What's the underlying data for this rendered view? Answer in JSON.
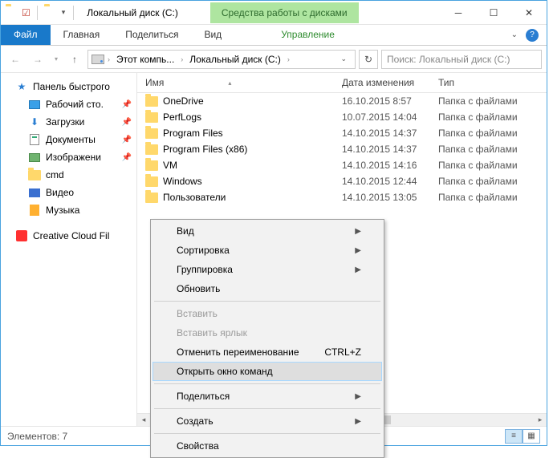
{
  "title": "Локальный диск (C:)",
  "drive_tools": "Средства работы с дисками",
  "ribbon": {
    "file": "Файл",
    "home": "Главная",
    "share": "Поделиться",
    "view": "Вид",
    "manage": "Управление"
  },
  "breadcrumb": {
    "pc": "Этот компь...",
    "drive": "Локальный диск (C:)"
  },
  "search_placeholder": "Поиск: Локальный диск (С:)",
  "nav": {
    "quick": "Панель быстрого",
    "desktop": "Рабочий сто.",
    "downloads": "Загрузки",
    "documents": "Документы",
    "pictures": "Изображени",
    "cmd": "cmd",
    "video": "Видео",
    "music": "Музыка",
    "cc": "Creative Cloud Fil"
  },
  "columns": {
    "name": "Имя",
    "date": "Дата изменения",
    "type": "Тип"
  },
  "folder_type": "Папка с файлами",
  "rows": [
    {
      "name": "OneDrive",
      "date": "16.10.2015 8:57"
    },
    {
      "name": "PerfLogs",
      "date": "10.07.2015 14:04"
    },
    {
      "name": "Program Files",
      "date": "14.10.2015 14:37"
    },
    {
      "name": "Program Files (x86)",
      "date": "14.10.2015 14:37"
    },
    {
      "name": "VM",
      "date": "14.10.2015 14:16"
    },
    {
      "name": "Windows",
      "date": "14.10.2015 12:44"
    },
    {
      "name": "Пользователи",
      "date": "14.10.2015 13:05"
    }
  ],
  "status": "Элементов: 7",
  "ctx": {
    "view": "Вид",
    "sort": "Сортировка",
    "group": "Группировка",
    "refresh": "Обновить",
    "paste": "Вставить",
    "paste_shortcut": "Вставить ярлык",
    "undo_rename": "Отменить переименование",
    "undo_key": "CTRL+Z",
    "open_cmd": "Открыть окно команд",
    "share": "Поделиться",
    "new": "Создать",
    "properties": "Свойства"
  }
}
